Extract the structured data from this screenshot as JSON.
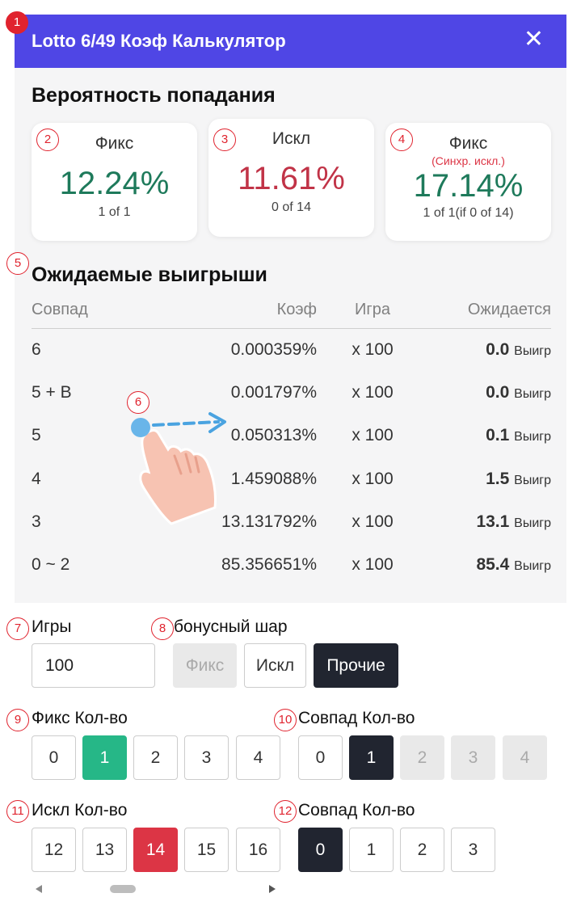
{
  "header": {
    "title": "Lotto 6/49 Коэф Калькулятор",
    "close_label": "✕"
  },
  "probability": {
    "heading": "Вероятность попадания",
    "cards": [
      {
        "label": "Фикс",
        "sub": "",
        "percent": "12.24%",
        "count": "1 of 1"
      },
      {
        "label": "Искл",
        "sub": "",
        "percent": "11.61%",
        "count": "0 of 14"
      },
      {
        "label": "Фикс",
        "sub": "(Синхр. искл.)",
        "percent": "17.14%",
        "count": "1 of 1(if 0 of 14)"
      }
    ]
  },
  "expected": {
    "heading": "Ожидаемые выигрыши",
    "columns": [
      "Совпад",
      "Коэф",
      "Игра",
      "Ожидается"
    ],
    "unit": "Выигр",
    "rows": [
      {
        "match": "6",
        "coef": "0.000359%",
        "games": "x 100",
        "expected": "0.0"
      },
      {
        "match": "5 + B",
        "coef": "0.001797%",
        "games": "x 100",
        "expected": "0.0"
      },
      {
        "match": "5",
        "coef": "0.050313%",
        "games": "x 100",
        "expected": "0.1"
      },
      {
        "match": "4",
        "coef": "1.459088%",
        "games": "x 100",
        "expected": "1.5"
      },
      {
        "match": "3",
        "coef": "13.131792%",
        "games": "x 100",
        "expected": "13.1"
      },
      {
        "match": "0 ~ 2",
        "coef": "85.356651%",
        "games": "x 100",
        "expected": "85.4"
      }
    ]
  },
  "controls": {
    "games_label": "Игры",
    "games_value": "100",
    "bonus_label": "бонусный шар",
    "bonus_options": [
      "Фикс",
      "Искл",
      "Прочие"
    ],
    "fix_count_label": "Фикс Кол-во",
    "fix_count_options": [
      "0",
      "1",
      "2",
      "3",
      "4"
    ],
    "match_count_label_1": "Совпад Кол-во",
    "match_count_options_1": [
      "0",
      "1",
      "2",
      "3",
      "4"
    ],
    "excl_count_label": "Искл Кол-во",
    "excl_count_options": [
      "12",
      "13",
      "14",
      "15",
      "16"
    ],
    "match_count_label_2": "Совпад Кол-во",
    "match_count_options_2": [
      "0",
      "1",
      "2",
      "3"
    ]
  },
  "markers": [
    "1",
    "2",
    "3",
    "4",
    "5",
    "6",
    "7",
    "8",
    "9",
    "10",
    "11",
    "12"
  ],
  "colors": {
    "header": "#4f46e5",
    "green": "#1e7a5b",
    "red": "#c13347",
    "selected_green": "#26b787",
    "selected_red": "#dc3545",
    "selected_dark": "#212530"
  }
}
